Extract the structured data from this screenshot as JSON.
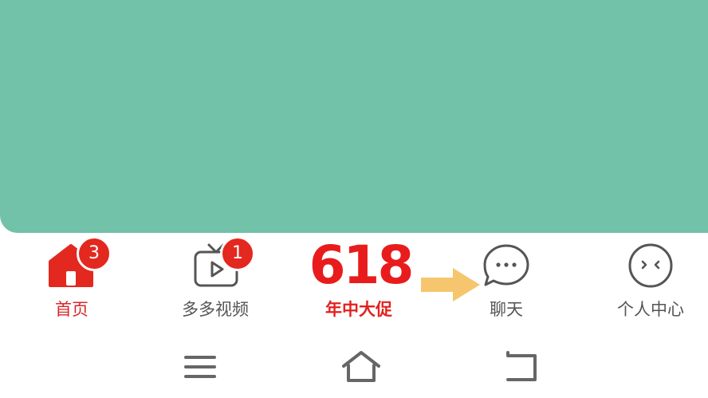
{
  "tabs": [
    {
      "label": "首页",
      "icon": "home-icon",
      "badge": "3",
      "active": true
    },
    {
      "label": "多多视频",
      "icon": "video-tv-icon",
      "badge": "1",
      "active": false
    },
    {
      "label": "年中大促",
      "icon": "promo-618-icon",
      "promo_number": "618",
      "active": false
    },
    {
      "label": "聊天",
      "icon": "chat-bubble-icon",
      "active": false
    },
    {
      "label": "个人中心",
      "icon": "profile-face-icon",
      "active": false
    }
  ],
  "annotation": {
    "icon": "arrow-right-icon",
    "color": "#f5c66e"
  },
  "system_nav": [
    {
      "icon": "menu-icon"
    },
    {
      "icon": "home-outline-icon"
    },
    {
      "icon": "back-icon"
    }
  ],
  "colors": {
    "banner": "#72c1a9",
    "accent_red": "#e3281f",
    "label_gray": "#555555",
    "arrow": "#f5c66e"
  }
}
